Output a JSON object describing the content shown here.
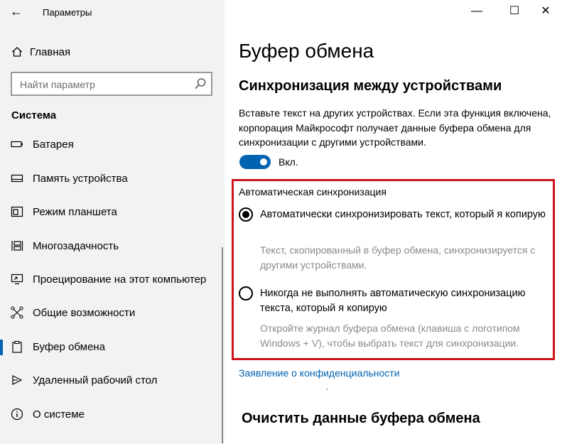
{
  "window": {
    "title": "Параметры",
    "back_glyph": "←",
    "minimize_glyph": "—",
    "maximize_glyph": "☐",
    "close_glyph": "✕"
  },
  "sidebar": {
    "home_label": "Главная",
    "search_placeholder": "Найти параметр",
    "section_title": "Система",
    "items": [
      {
        "label": "Батарея",
        "icon": "battery-icon"
      },
      {
        "label": "Память устройства",
        "icon": "storage-icon"
      },
      {
        "label": "Режим планшета",
        "icon": "tablet-mode-icon"
      },
      {
        "label": "Многозадачность",
        "icon": "multitasking-icon"
      },
      {
        "label": "Проецирование на этот компьютер",
        "icon": "projecting-icon"
      },
      {
        "label": "Общие возможности",
        "icon": "shared-experiences-icon"
      },
      {
        "label": "Буфер обмена",
        "icon": "clipboard-icon",
        "active": true
      },
      {
        "label": "Удаленный рабочий стол",
        "icon": "remote-desktop-icon"
      },
      {
        "label": "О системе",
        "icon": "info-icon"
      }
    ]
  },
  "main": {
    "page_title": "Буфер обмена",
    "sync_title": "Синхронизация между устройствами",
    "sync_desc": "Вставьте текст на других устройствах. Если эта функция включена, корпорация Майкрософт получает данные буфера обмена для синхронизации с другими устройствами.",
    "toggle_state": "Вкл.",
    "auto_sync_title": "Автоматическая синхронизация",
    "option1_label": "Автоматически синхронизировать текст, который я копирую",
    "option1_desc": "Текст, скопированный в буфер обмена, синхронизируется с другими устройствами.",
    "option2_label": "Никогда не выполнять автоматическую синхронизацию текста, который я копирую",
    "option2_desc": "Откройте журнал буфера обмена (клавиша с логотипом Windows + V), чтобы выбрать текст для синхронизации.",
    "privacy_link": "Заявление о конфиденциальности",
    "clear_title": "Очистить данные буфера обмена"
  },
  "colors": {
    "accent": "#0063b1",
    "highlight_border": "#d0121b",
    "sidebar_bg": "#f2f2f2",
    "secondary_text": "#8a8a8a"
  }
}
